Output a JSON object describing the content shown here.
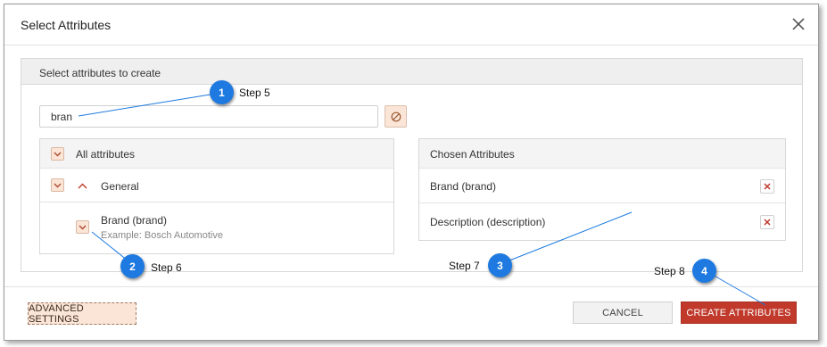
{
  "dialog": {
    "title": "Select Attributes",
    "close_icon": "close-icon"
  },
  "panel": {
    "heading": "Select attributes to create",
    "search": {
      "value": "bran",
      "placeholder": ""
    },
    "clear_icon": "clear-filter-icon",
    "all_attributes": {
      "header": "All attributes",
      "groups": [
        {
          "label": "General",
          "expanded": true,
          "items": [
            {
              "label": "Brand (brand)",
              "example": "Example: Bosch Automotive",
              "checked": true
            }
          ]
        }
      ]
    },
    "chosen": {
      "header": "Chosen Attributes",
      "items": [
        {
          "label": "Brand (brand)"
        },
        {
          "label": "Description (description)"
        }
      ]
    }
  },
  "footer": {
    "advanced_label": "ADVANCED SETTINGS",
    "cancel_label": "CANCEL",
    "create_label": "CREATE ATTRIBUTES"
  },
  "annotations": [
    {
      "number": "1",
      "label": "Step 5"
    },
    {
      "number": "2",
      "label": "Step 6"
    },
    {
      "number": "3",
      "label": "Step 7"
    },
    {
      "number": "4",
      "label": "Step 8"
    }
  ],
  "colors": {
    "accent": "#c0392b",
    "checkbox_fill": "#fbe5d6",
    "badge": "#1e7ae0"
  }
}
